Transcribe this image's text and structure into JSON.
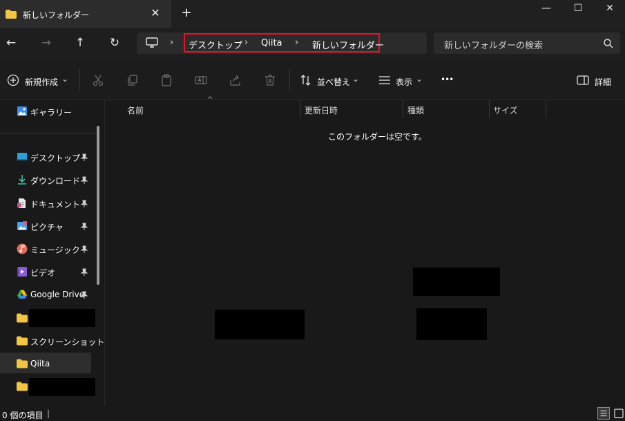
{
  "window": {
    "tab_title": "新しいフォルダー",
    "tab_close": "✕",
    "new_tab": "+",
    "minimize": "—",
    "maximize": "☐",
    "close": "✕"
  },
  "nav": {
    "back": "←",
    "forward": "→",
    "up": "↑",
    "refresh": "↻"
  },
  "address": {
    "crumbs": [
      "デスクトップ",
      "Qiita",
      "新しいフォルダー"
    ],
    "chevron": "›"
  },
  "search": {
    "placeholder": "新しいフォルダーの検索"
  },
  "toolbar": {
    "new_label": "新規作成",
    "sort_label": "並べ替え",
    "view_label": "表示",
    "more": "•••",
    "details_label": "詳細",
    "dropdown": "⌄"
  },
  "sidebar": {
    "gallery": "ギャラリー",
    "items": [
      {
        "label": "デスクトップ",
        "icon": "desktop-icon",
        "pinned": true
      },
      {
        "label": "ダウンロード",
        "icon": "download-icon",
        "pinned": true
      },
      {
        "label": "ドキュメント",
        "icon": "documents-icon",
        "pinned": true
      },
      {
        "label": "ピクチャ",
        "icon": "pictures-icon",
        "pinned": true
      },
      {
        "label": "ミュージック",
        "icon": "music-icon",
        "pinned": true
      },
      {
        "label": "ビデオ",
        "icon": "videos-icon",
        "pinned": true
      },
      {
        "label": "Google Drive",
        "icon": "google-drive-icon",
        "pinned": true
      },
      {
        "label": "",
        "icon": "folder-icon",
        "pinned": false
      },
      {
        "label": "スクリーンショット",
        "icon": "folder-icon",
        "pinned": false
      },
      {
        "label": "Qiita",
        "icon": "folder-icon",
        "pinned": false,
        "selected": true
      },
      {
        "label": "",
        "icon": "folder-icon",
        "pinned": false
      }
    ]
  },
  "columns": [
    "名前",
    "更新日時",
    "種類",
    "サイズ"
  ],
  "content": {
    "empty_message": "このフォルダーは空です。"
  },
  "status": {
    "item_count": "0 個の項目",
    "divider": "|"
  },
  "colors": {
    "background": "#191919",
    "accent_red": "#e81123",
    "folder": "#f4c542"
  }
}
